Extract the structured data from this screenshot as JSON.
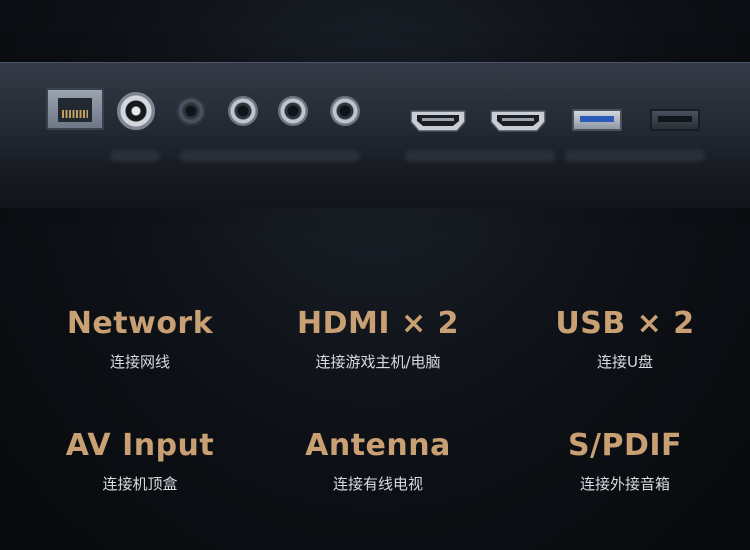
{
  "ports_visual": {
    "items": [
      {
        "icon": "ethernet-port-icon"
      },
      {
        "icon": "coax-antenna-port-icon"
      },
      {
        "icon": "audio-jack-icon"
      },
      {
        "icon": "audio-jack-icon"
      },
      {
        "icon": "audio-jack-icon"
      },
      {
        "icon": "audio-jack-icon"
      },
      {
        "icon": "hdmi-port-icon"
      },
      {
        "icon": "hdmi-port-icon"
      },
      {
        "icon": "usb-port-icon"
      },
      {
        "icon": "usb-port-icon"
      }
    ]
  },
  "features": [
    {
      "name": "Network",
      "desc": "连接网线"
    },
    {
      "name": "HDMI × 2",
      "desc": "连接游戏主机/电脑"
    },
    {
      "name": "USB × 2",
      "desc": "连接U盘"
    },
    {
      "name": "AV Input",
      "desc": "连接机顶盒"
    },
    {
      "name": "Antenna",
      "desc": "连接有线电视"
    },
    {
      "name": "S/PDIF",
      "desc": "连接外接音箱"
    }
  ],
  "colors": {
    "accent_gold": "#c8a073",
    "text_light": "#d7dadf",
    "background": "#0d1015"
  }
}
